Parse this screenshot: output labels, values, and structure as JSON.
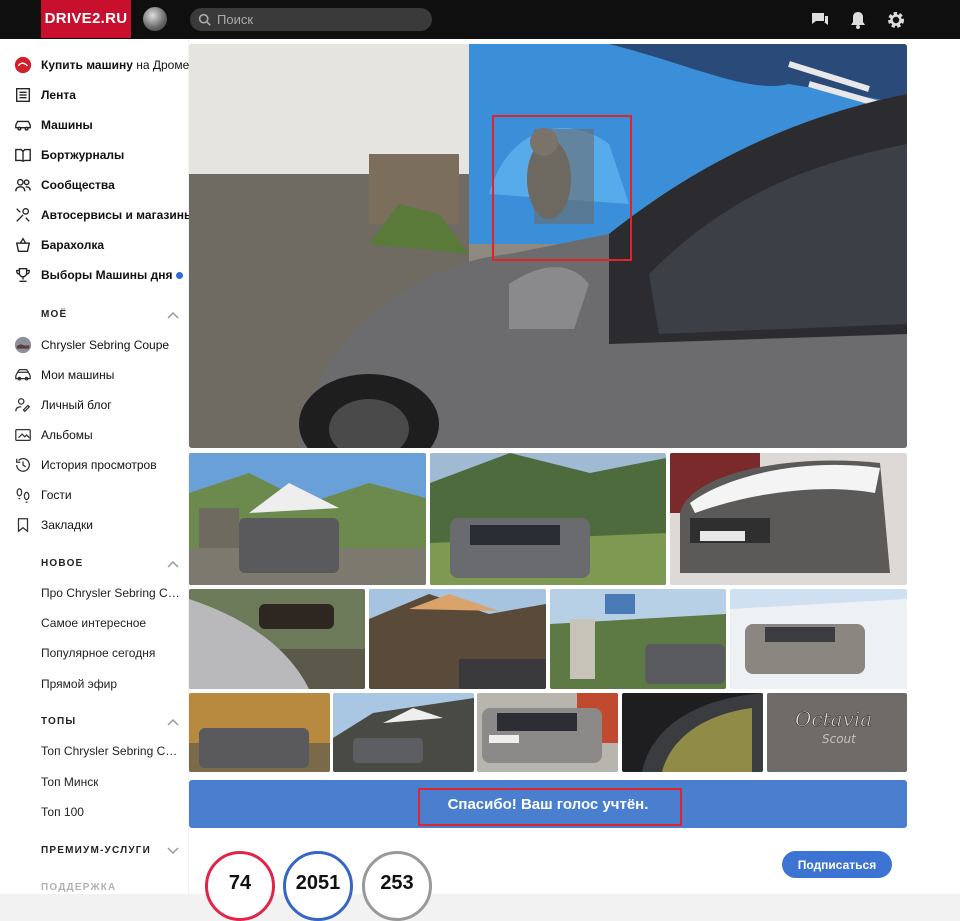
{
  "header": {
    "logo": "DRIVE2.RU",
    "search_placeholder": "Поиск"
  },
  "sidebar": {
    "items": [
      {
        "label": "Купить машину",
        "suffix": " на Дроме"
      },
      {
        "label": "Лента"
      },
      {
        "label": "Машины"
      },
      {
        "label": "Бортжурналы"
      },
      {
        "label": "Сообщества"
      },
      {
        "label": "Автосервисы и магазины"
      },
      {
        "label": "Барахолка"
      },
      {
        "label": "Выборы Машины дня"
      }
    ],
    "moe": {
      "title": "МОЁ",
      "items": [
        {
          "label": "Chrysler Sebring Coupe"
        },
        {
          "label": "Мои машины"
        },
        {
          "label": "Личный блог"
        },
        {
          "label": "Альбомы"
        },
        {
          "label": "История просмотров"
        },
        {
          "label": "Гости"
        },
        {
          "label": "Закладки"
        }
      ]
    },
    "novoe": {
      "title": "НОВОЕ",
      "items": [
        "Про Chrysler Sebring Co...",
        "Самое интересное",
        "Популярное сегодня",
        "Прямой эфир"
      ]
    },
    "topy": {
      "title": "ТОПЫ",
      "items": [
        "Топ Chrysler Sebring Co...",
        "Топ Минск",
        "Топ 100"
      ]
    },
    "premium": {
      "title": "ПРЕМИУМ-УСЛУГИ"
    },
    "support": {
      "title": "ПОДДЕРЖКА"
    }
  },
  "vote": {
    "message": "Спасибо! Ваш голос учтён."
  },
  "stats": {
    "values": [
      "74",
      "2051",
      "253"
    ],
    "colors": [
      "#e0244a",
      "#3566c4",
      "#999999"
    ],
    "subscribe_label": "Подписаться"
  },
  "colors": {
    "brand": "#c8102e",
    "accent": "#4a7fcf",
    "topbar": "#0f0f0f"
  },
  "icons": [
    "search-icon",
    "messages-icon",
    "bell-icon",
    "gear-icon"
  ]
}
